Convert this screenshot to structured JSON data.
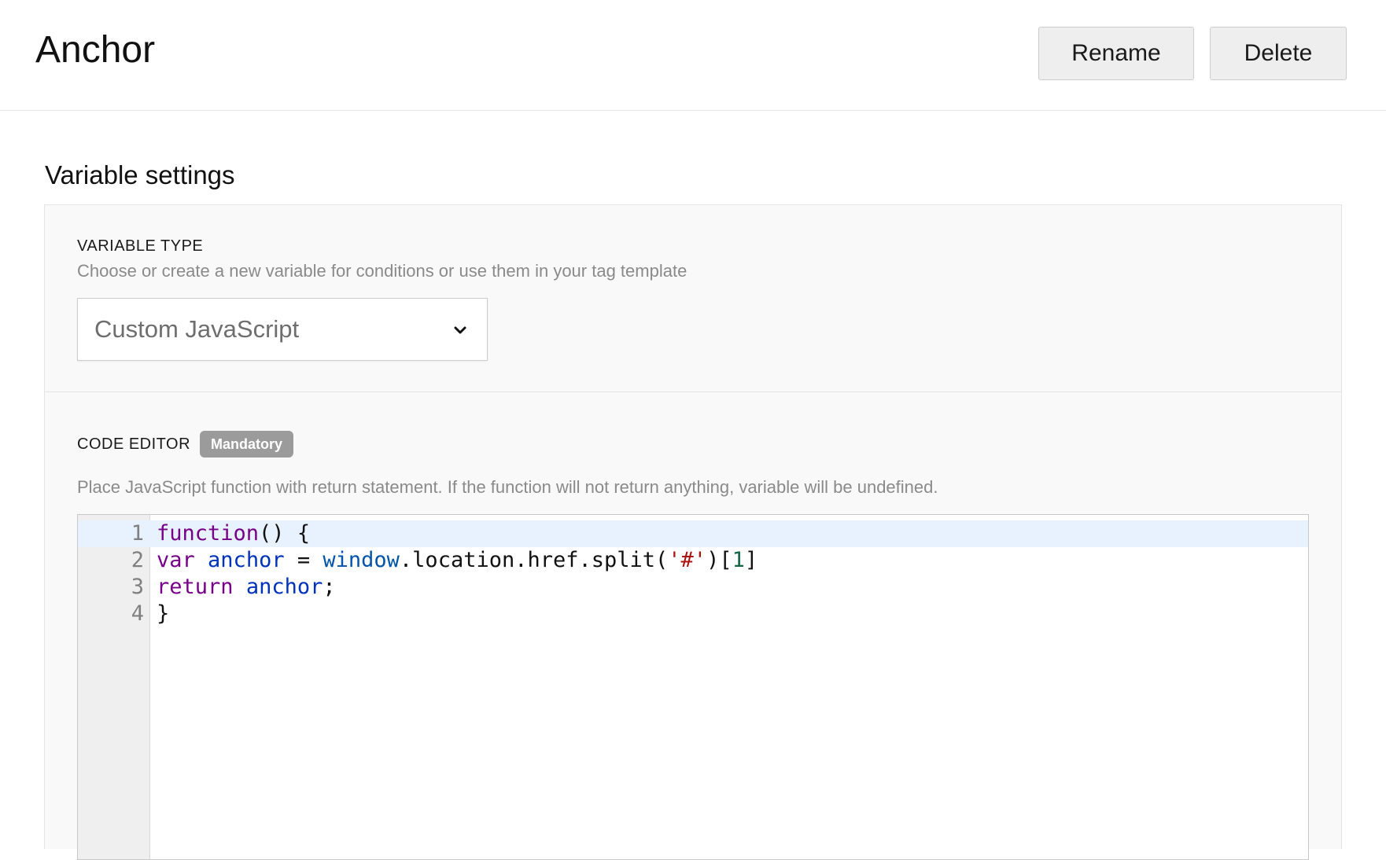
{
  "header": {
    "title": "Anchor",
    "rename_label": "Rename",
    "delete_label": "Delete"
  },
  "section": {
    "title": "Variable settings"
  },
  "variable_type": {
    "label": "VARIABLE TYPE",
    "help": "Choose or create a new variable for conditions or use them in your tag template",
    "selected": "Custom JavaScript",
    "chevron_icon": "chevron-down-icon"
  },
  "code_editor": {
    "label": "CODE EDITOR",
    "badge": "Mandatory",
    "help": "Place JavaScript function with return statement. If the function will not return anything, variable will be undefined.",
    "active_line": 1,
    "lines": [
      {
        "number": "1",
        "tokens": [
          [
            "kw",
            "function"
          ],
          [
            "",
            "() {"
          ]
        ]
      },
      {
        "number": "2",
        "tokens": [
          [
            "kw",
            "var"
          ],
          [
            "",
            " "
          ],
          [
            "vr",
            "anchor"
          ],
          [
            "",
            " = "
          ],
          [
            "bl",
            "window"
          ],
          [
            "",
            ".location.href.split("
          ],
          [
            "st",
            "'#'"
          ],
          [
            "",
            ")["
          ],
          [
            "nm",
            "1"
          ],
          [
            "",
            "]"
          ]
        ]
      },
      {
        "number": "3",
        "tokens": [
          [
            "kw",
            "return"
          ],
          [
            "",
            " "
          ],
          [
            "vr",
            "anchor"
          ],
          [
            "",
            ";"
          ]
        ]
      },
      {
        "number": "4",
        "tokens": [
          [
            "",
            "}"
          ]
        ]
      }
    ]
  }
}
